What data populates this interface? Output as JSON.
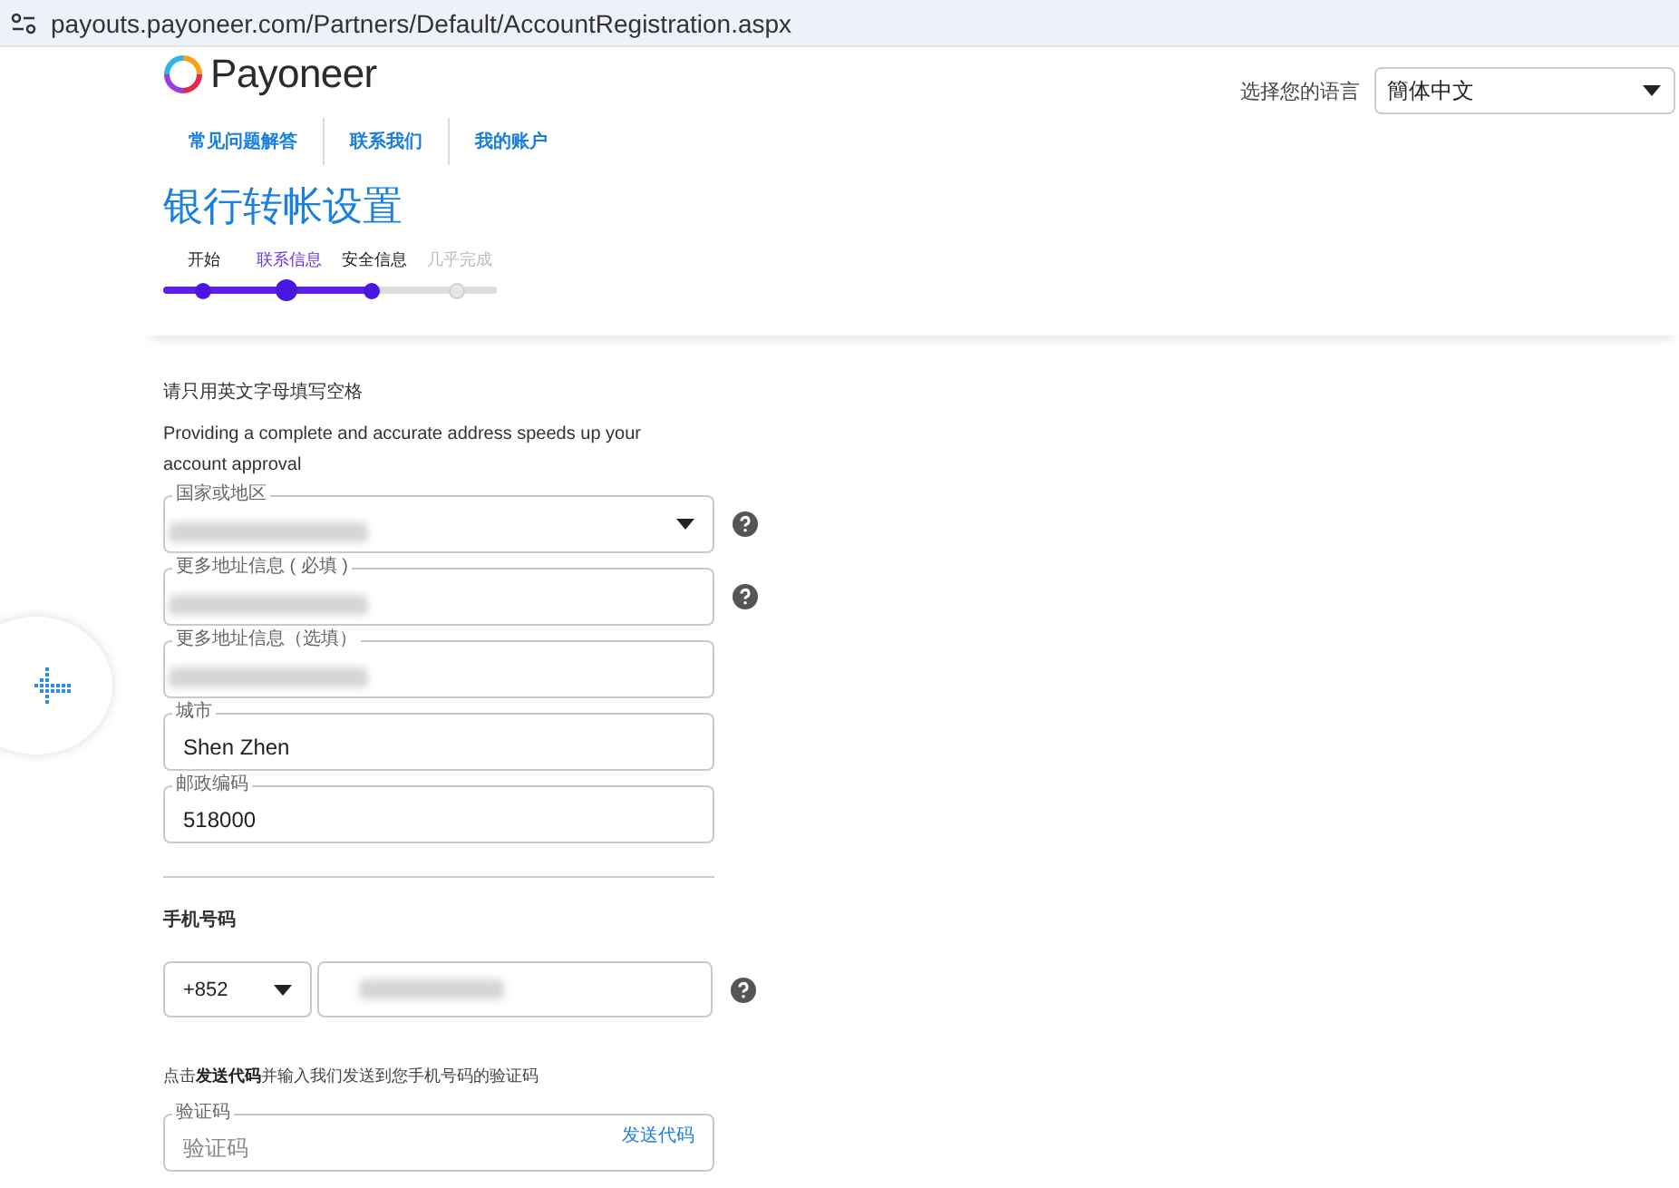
{
  "address_bar": {
    "url": "payouts.payoneer.com/Partners/Default/AccountRegistration.aspx"
  },
  "logo": {
    "text": "Payoneer"
  },
  "language": {
    "label": "选择您的语言",
    "value": "簡体中文"
  },
  "nav": [
    {
      "label": "常见问题解答"
    },
    {
      "label": "联系我们"
    },
    {
      "label": "我的账户"
    }
  ],
  "title": "银行转帐设置",
  "steps": [
    {
      "label": "开始",
      "completed": true,
      "selected": false
    },
    {
      "label": "联系信息",
      "completed": true,
      "selected": true
    },
    {
      "label": "安全信息",
      "completed": true,
      "selected": false
    },
    {
      "label": "几乎完成",
      "completed": false,
      "selected": false
    }
  ],
  "notice": "请只用英文字母填写空格",
  "hint": "Providing a complete and accurate address speeds up your account approval",
  "address_fields": [
    {
      "kind": "select",
      "label": "国家或地区",
      "help": true
    },
    {
      "kind": "text",
      "label": "更多地址信息 ( 必填 )",
      "help": true
    },
    {
      "kind": "text",
      "label": "更多地址信息（选填）",
      "help": false
    },
    {
      "kind": "text",
      "label": "城市",
      "value": "Shen Zhen",
      "help": false
    },
    {
      "kind": "text",
      "label": "邮政编码",
      "value": "518000",
      "help": false
    }
  ],
  "phone": {
    "heading": "手机号码",
    "country_code": "+852",
    "help": true
  },
  "code_instruction": "点击**发送代码**并输入我们发送到您手机号码的验证码",
  "verification": {
    "label": "验证码",
    "placeholder": "验证码",
    "action": "发送代码"
  }
}
